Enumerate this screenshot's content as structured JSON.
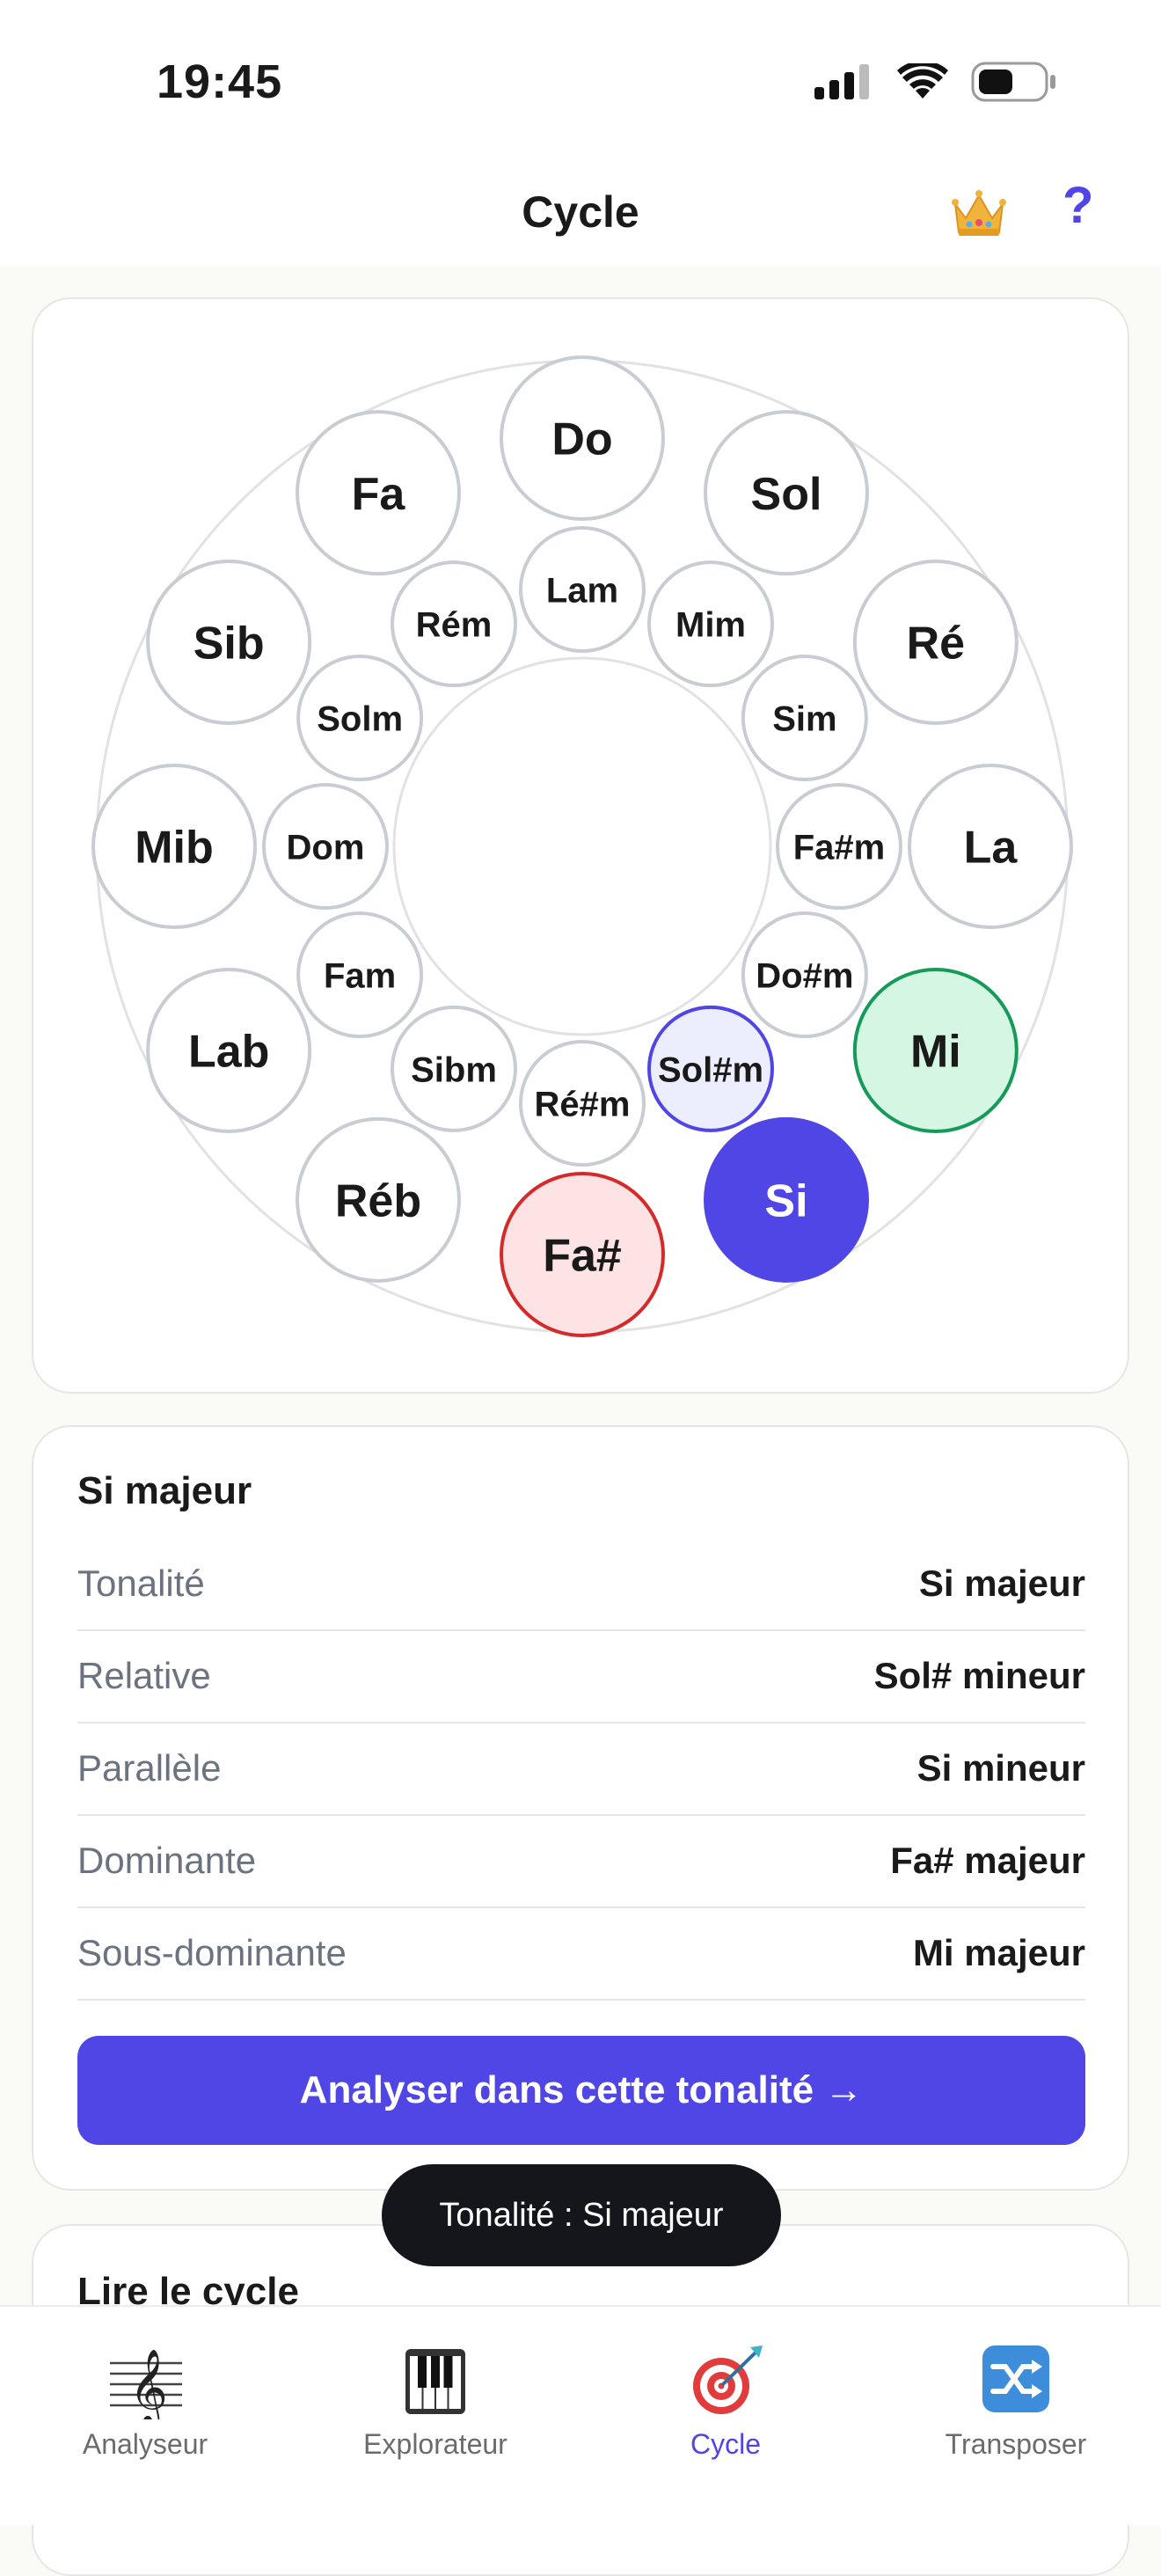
{
  "status": {
    "time": "19:45"
  },
  "header": {
    "title": "Cycle",
    "crown_icon": "crown-icon",
    "help_label": "?"
  },
  "wheel": {
    "major_keys": [
      "Do",
      "Sol",
      "Ré",
      "La",
      "Mi",
      "Si",
      "Fa#",
      "Réb",
      "Lab",
      "Mib",
      "Sib",
      "Fa"
    ],
    "minor_keys": [
      "Lam",
      "Mim",
      "Sim",
      "Fa#m",
      "Do#m",
      "Sol#m",
      "Ré#m",
      "Sibm",
      "Fam",
      "Dom",
      "Solm",
      "Rém"
    ],
    "selected_major": "Si",
    "highlight_relative": "Sol#m",
    "highlight_dominant": "Fa#",
    "highlight_subdominant": "Mi",
    "colors": {
      "accent": "#5046E5",
      "relative_fill": "#ECEEFD",
      "dominant_fill": "#FDE3E3",
      "dominant_stroke": "#D42A2A",
      "subdominant_fill": "#D5F6E3",
      "subdominant_stroke": "#169A5A",
      "default_stroke": "#C9CCD3"
    }
  },
  "info": {
    "title": "Si majeur",
    "rows": [
      {
        "label": "Tonalité",
        "value": "Si majeur"
      },
      {
        "label": "Relative",
        "value": "Sol# mineur"
      },
      {
        "label": "Parallèle",
        "value": "Si mineur"
      },
      {
        "label": "Dominante",
        "value": "Fa# majeur"
      },
      {
        "label": "Sous-dominante",
        "value": "Mi majeur"
      }
    ],
    "button_label": "Analyser dans cette tonalité →"
  },
  "toast": "Tonalité : Si majeur",
  "cycle_card": {
    "title": "Lire le cycle"
  },
  "tabs": [
    {
      "label": "Analyseur",
      "icon": "treble-clef-icon",
      "active": false
    },
    {
      "label": "Explorateur",
      "icon": "piano-keys-icon",
      "active": false
    },
    {
      "label": "Cycle",
      "icon": "dart-target-icon",
      "active": true
    },
    {
      "label": "Transposer",
      "icon": "shuffle-icon",
      "active": false
    }
  ]
}
